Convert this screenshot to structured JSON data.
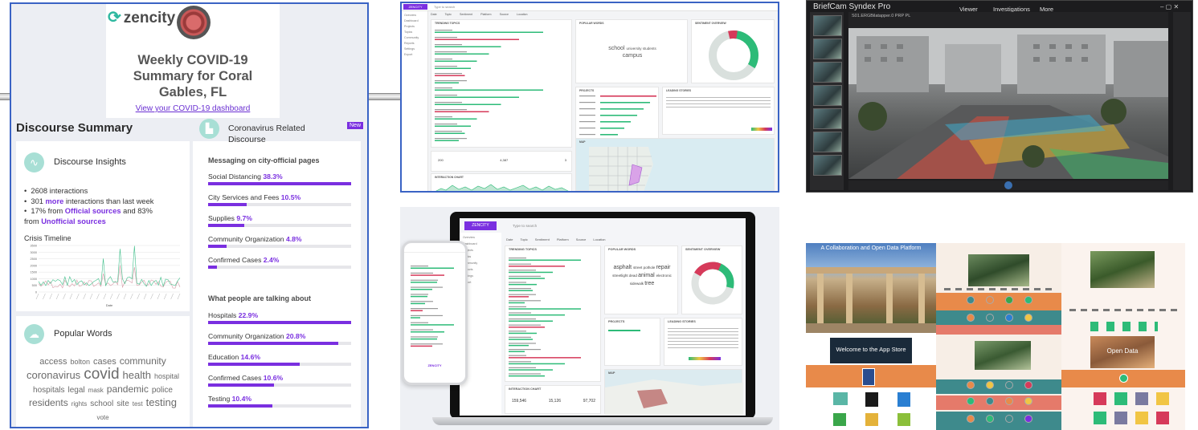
{
  "zencity": {
    "logo": "zencity",
    "hero_title": "Weekly COVID-19 Summary for Coral Gables, FL",
    "dashboard_link": "View your COVID-19 dashboard",
    "discourse_summary": "Discourse Summary",
    "insights": {
      "title": "Discourse Insights",
      "b1": "2608 interactions",
      "b2_pre": "301 ",
      "b2_em": "more",
      "b2_post": " interactions than last week",
      "b3_pre": "17% from ",
      "b3_em1": "Official sources",
      "b3_mid": " and 83%",
      "b3_pre2": "from ",
      "b3_em2": "Unofficial sources",
      "timeline_title": "Crisis Timeline",
      "timeline_xlabel": "Date",
      "timeline_yticks": [
        "3500",
        "3000",
        "2500",
        "2000",
        "1500",
        "1000",
        "500",
        "0"
      ]
    },
    "popular_words": {
      "title": "Popular Words",
      "words": [
        {
          "w": "access",
          "s": 11
        },
        {
          "w": "bolton",
          "s": 9
        },
        {
          "w": "cases",
          "s": 11
        },
        {
          "w": "community",
          "s": 12
        },
        {
          "w": "coronavirus",
          "s": 13
        },
        {
          "w": "covid",
          "s": 19
        },
        {
          "w": "health",
          "s": 13
        },
        {
          "w": "hospital",
          "s": 9
        },
        {
          "w": "hospitals",
          "s": 10
        },
        {
          "w": "legal",
          "s": 10
        },
        {
          "w": "mask",
          "s": 8
        },
        {
          "w": "pandemic",
          "s": 12
        },
        {
          "w": "police",
          "s": 10
        },
        {
          "w": "residents",
          "s": 12
        },
        {
          "w": "rights",
          "s": 8
        },
        {
          "w": "school",
          "s": 10
        },
        {
          "w": "site",
          "s": 10
        },
        {
          "w": "test",
          "s": 8
        },
        {
          "w": "testing",
          "s": 13
        },
        {
          "w": "vote",
          "s": 8
        }
      ]
    },
    "related": {
      "title": "Coronavirus Related Discourse",
      "badge": "New",
      "section1": "Messaging on city-official pages",
      "official": [
        {
          "label": "Social Distancing",
          "pct": "38.3%",
          "v": 1.0
        },
        {
          "label": "City Services and Fees",
          "pct": "10.5%",
          "v": 0.27
        },
        {
          "label": "Supplies",
          "pct": "9.7%",
          "v": 0.25
        },
        {
          "label": "Community Organization",
          "pct": "4.8%",
          "v": 0.13
        },
        {
          "label": "Confirmed Cases",
          "pct": "2.4%",
          "v": 0.06
        }
      ],
      "section2": "What people are talking about",
      "people": [
        {
          "label": "Hospitals",
          "pct": "22.9%",
          "v": 1.0
        },
        {
          "label": "Community Organization",
          "pct": "20.8%",
          "v": 0.91
        },
        {
          "label": "Education",
          "pct": "14.6%",
          "v": 0.64
        },
        {
          "label": "Confirmed Cases",
          "pct": "10.6%",
          "v": 0.46
        },
        {
          "label": "Testing",
          "pct": "10.4%",
          "v": 0.45
        }
      ]
    }
  },
  "desktop": {
    "brand": "ZENCITY",
    "search": "Type to search",
    "side_items": [
      "Overview",
      "Dashboard",
      "Projects",
      "Topics",
      "Community",
      "Reports",
      "Settings",
      "Export"
    ],
    "tabs": [
      "Date",
      "Topic",
      "Sentiment",
      "Platform",
      "Source",
      "Location"
    ],
    "boxes": {
      "trending": "TRENDING TOPICS",
      "popular": "POPULAR WORDS",
      "sentiment": "SENTIMENT OVERVIEW",
      "projects": "PROJECTS",
      "leading": "LEADING STORIES",
      "interaction": "INTERACTION CHART",
      "map": "MAP"
    },
    "cloud_words": [
      "school",
      "university",
      "students",
      "campus"
    ],
    "stats": [
      "200",
      "4,387",
      "3"
    ],
    "accent": "#7a2fe0"
  },
  "briefcam": {
    "title": "BriefCam Syndex Pro",
    "nav": [
      "Viewer",
      "Investigations",
      "More"
    ],
    "video_info": "S01.ERGBilatapper.0 PRP PL"
  },
  "laptop": {
    "brand": "ZENCITY",
    "search": "Type to search",
    "tabs": [
      "Date",
      "Topic",
      "Sentiment",
      "Platform",
      "Source",
      "Location"
    ],
    "boxes": {
      "trending": "TRENDING TOPICS",
      "popular": "POPULAR WORDS",
      "sentiment": "SENTIMENT OVERVIEW",
      "projects": "PROJECTS",
      "leading": "LEADING STORIES",
      "interaction": "INTERACTION CHART",
      "map": "MAP"
    },
    "cloud_words": [
      "asphalt",
      "street",
      "pothole",
      "repair",
      "streetlight",
      "dead",
      "animal",
      "electronic",
      "sidewalk",
      "tree"
    ],
    "stats": [
      "159,546",
      "15,126",
      "97,702"
    ],
    "phone_brand": "ZENCITY"
  },
  "portal": {
    "titles": [
      "A Collaboration and Open Data Platform",
      "Welcome to the App Store",
      "Open Data"
    ],
    "colors": [
      "#e88a4a",
      "#3e8a8c",
      "#d96b6b",
      "#f1c544"
    ]
  }
}
